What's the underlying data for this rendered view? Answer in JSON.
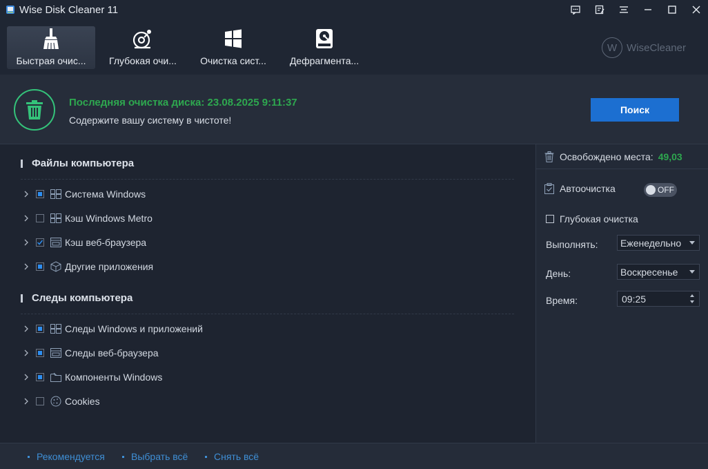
{
  "window": {
    "title": "Wise Disk Cleaner 11",
    "controls": [
      "feedback-icon",
      "notes-icon",
      "menu-icon",
      "minimize-icon",
      "maximize-icon",
      "close-icon"
    ]
  },
  "tabs": [
    {
      "label": "Быстрая очис...",
      "icon": "broom-icon",
      "active": true
    },
    {
      "label": "Глубокая очи...",
      "icon": "deep-scan-icon",
      "active": false
    },
    {
      "label": "Очистка сист...",
      "icon": "windows-icon",
      "active": false
    },
    {
      "label": "Дефрагмента...",
      "icon": "disk-icon",
      "active": false
    }
  ],
  "brand": {
    "letter": "W",
    "name": "WiseCleaner"
  },
  "header": {
    "last_clean": "Последняя очистка диска: 23.08.2025 9:11:37",
    "subtitle": "Содержите вашу систему в чистоте!",
    "search_label": "Поиск"
  },
  "sections": [
    {
      "title": "Файлы компьютера",
      "items": [
        {
          "label": "Система Windows",
          "check": "partial",
          "icon": "windows-tile-icon"
        },
        {
          "label": "Кэш Windows Metro",
          "check": "unchecked",
          "icon": "windows-tile-icon"
        },
        {
          "label": "Кэш веб-браузера",
          "check": "checked",
          "icon": "browser-icon"
        },
        {
          "label": "Другие приложения",
          "check": "partial",
          "icon": "box-icon"
        }
      ]
    },
    {
      "title": "Следы компьютера",
      "items": [
        {
          "label": "Следы Windows и приложений",
          "check": "partial",
          "icon": "windows-tile-icon"
        },
        {
          "label": "Следы веб-браузера",
          "check": "partial",
          "icon": "browser-icon"
        },
        {
          "label": "Компоненты Windows",
          "check": "partial",
          "icon": "folder-icon"
        },
        {
          "label": "Cookies",
          "check": "unchecked",
          "icon": "cookie-icon"
        }
      ]
    }
  ],
  "right": {
    "freed_label": "Освобождено места:",
    "freed_value": "49,03",
    "auto_label": "Автоочистка",
    "auto_toggle": "OFF",
    "deep_label": "Глубокая очистка",
    "run_label": "Выполнять:",
    "run_value": "Еженедельно",
    "day_label": "День:",
    "day_value": "Воскресенье",
    "time_label": "Время:",
    "time_value": "09:25"
  },
  "footer": {
    "recommended": "Рекомендуется",
    "select_all": "Выбрать всё",
    "deselect_all": "Снять всё"
  },
  "colors": {
    "accent_green": "#2ea84f",
    "button_blue": "#1c6fd1",
    "link_blue": "#3f8fd6",
    "check_blue": "#2d8ef0"
  }
}
